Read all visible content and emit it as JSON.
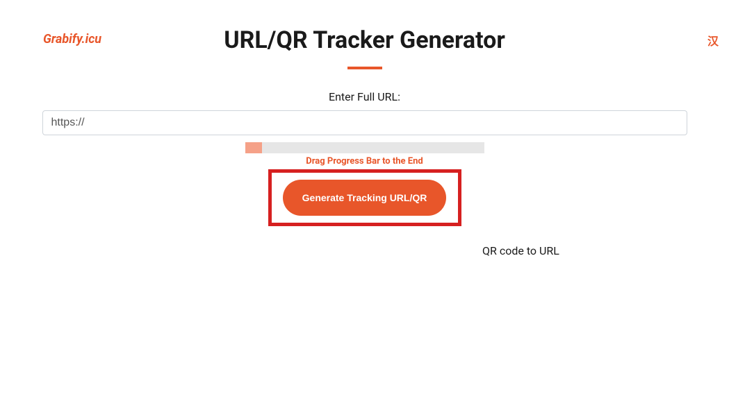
{
  "header": {
    "brand": "Grabify.icu",
    "lang_toggle": "汉"
  },
  "main": {
    "title": "URL/QR Tracker Generator",
    "form": {
      "label": "Enter Full URL:",
      "url_value": "https://",
      "progress_hint": "Drag Progress Bar to the End",
      "generate_label": "Generate Tracking URL/QR",
      "qr_link_label": "QR code to URL"
    }
  }
}
